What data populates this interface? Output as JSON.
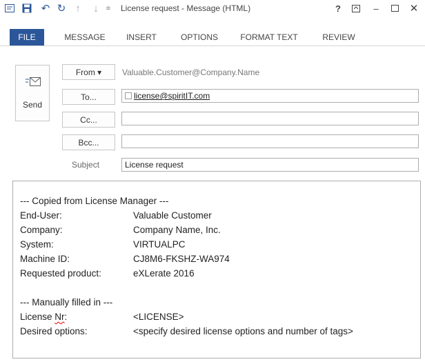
{
  "window": {
    "title": "License request - Message (HTML)",
    "help_label": "?"
  },
  "quick_access": {
    "icons": [
      "message-icon",
      "save-icon",
      "undo-icon",
      "redo-icon",
      "up-arrow-icon",
      "down-arrow-icon",
      "customize-icon"
    ]
  },
  "tabs": [
    {
      "label": "FILE",
      "active": true
    },
    {
      "label": "MESSAGE",
      "active": false
    },
    {
      "label": "INSERT",
      "active": false
    },
    {
      "label": "OPTIONS",
      "active": false
    },
    {
      "label": "FORMAT TEXT",
      "active": false
    },
    {
      "label": "REVIEW",
      "active": false
    }
  ],
  "colors": {
    "accent": "#2b579a",
    "spellcheck": "#dd0000"
  },
  "header": {
    "send_label": "Send",
    "from_label": "From ▾",
    "from_value": "Valuable.Customer@Company.Name",
    "to_label": "To...",
    "to_value": "license@spiritIT.com",
    "cc_label": "Cc...",
    "cc_value": "",
    "bcc_label": "Bcc...",
    "bcc_value": "",
    "subject_label": "Subject",
    "subject_value": "License request"
  },
  "body": {
    "section1_title": "--- Copied from License Manager ---",
    "rows1": [
      {
        "key": "End-User:",
        "value": "Valuable Customer"
      },
      {
        "key": "Company:",
        "value": "Company Name, Inc."
      },
      {
        "key": "System:",
        "value": "VIRTUALPC"
      },
      {
        "key": "Machine ID:",
        "value": "CJ8M6-FKSHZ-WA974"
      },
      {
        "key": "Requested product:",
        "value": "eXLerate 2016"
      }
    ],
    "section2_title": "--- Manually filled in ---",
    "license_key_prefix": "License ",
    "license_key_word": "Nr",
    "license_key_suffix": ":",
    "license_value": "<LICENSE>",
    "options_key": "Desired options:",
    "options_value": "<specify desired license options and number of tags>"
  }
}
